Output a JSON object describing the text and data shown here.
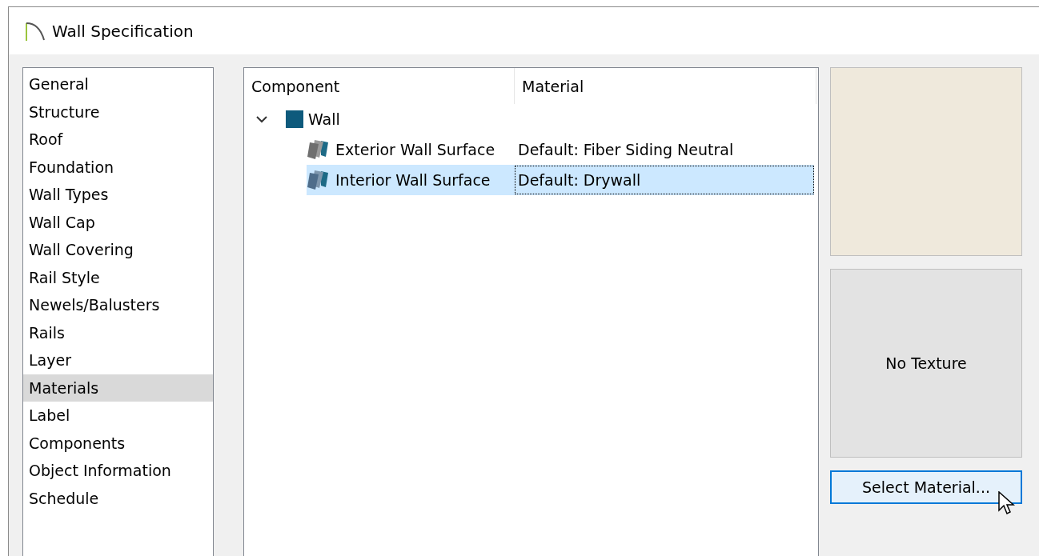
{
  "window": {
    "title": "Wall Specification"
  },
  "sidebar": {
    "items": [
      {
        "label": "General",
        "selected": false
      },
      {
        "label": "Structure",
        "selected": false
      },
      {
        "label": "Roof",
        "selected": false
      },
      {
        "label": "Foundation",
        "selected": false
      },
      {
        "label": "Wall Types",
        "selected": false
      },
      {
        "label": "Wall Cap",
        "selected": false
      },
      {
        "label": "Wall Covering",
        "selected": false
      },
      {
        "label": "Rail Style",
        "selected": false
      },
      {
        "label": "Newels/Balusters",
        "selected": false
      },
      {
        "label": "Rails",
        "selected": false
      },
      {
        "label": "Layer",
        "selected": false
      },
      {
        "label": "Materials",
        "selected": true
      },
      {
        "label": "Label",
        "selected": false
      },
      {
        "label": "Components",
        "selected": false
      },
      {
        "label": "Object Information",
        "selected": false
      },
      {
        "label": "Schedule",
        "selected": false
      }
    ]
  },
  "tree": {
    "columns": [
      "Component",
      "Material"
    ],
    "rows": [
      {
        "component": "Wall",
        "kind": "group",
        "expanded": true,
        "selected": false,
        "children": [
          {
            "component": "Exterior Wall Surface",
            "material": "Default: Fiber Siding Neutral",
            "kind": "surface",
            "selected": false
          },
          {
            "component": "Interior Wall Surface",
            "material": "Default: Drywall",
            "kind": "surface",
            "selected": true
          }
        ]
      }
    ]
  },
  "preview": {
    "texture_label": "No Texture"
  },
  "buttons": [
    {
      "label": "Select Material...",
      "hovered": true
    }
  ]
}
